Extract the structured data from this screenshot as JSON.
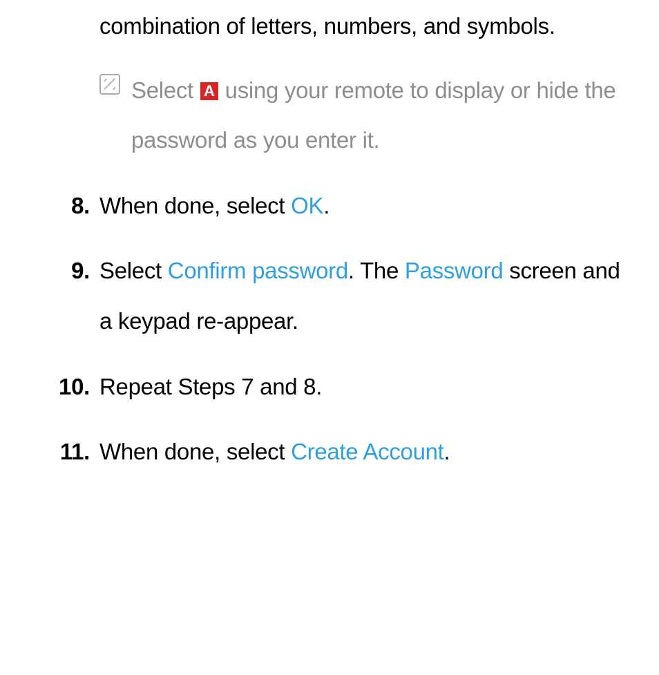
{
  "continuation_text": "combination of letters, numbers, and symbols.",
  "note": {
    "prefix": "Select ",
    "button_label": "A",
    "suffix": " using your remote to display or hide the password as you enter it."
  },
  "steps": [
    {
      "number": "8.",
      "parts": [
        {
          "text": "When done, select ",
          "link": false
        },
        {
          "text": "OK",
          "link": true
        },
        {
          "text": ".",
          "link": false
        }
      ]
    },
    {
      "number": "9.",
      "parts": [
        {
          "text": "Select ",
          "link": false
        },
        {
          "text": "Confirm password",
          "link": true
        },
        {
          "text": ". The ",
          "link": false
        },
        {
          "text": "Password",
          "link": true
        },
        {
          "text": " screen and a keypad re-appear.",
          "link": false
        }
      ]
    },
    {
      "number": "10.",
      "parts": [
        {
          "text": "Repeat Steps 7 and 8.",
          "link": false
        }
      ]
    },
    {
      "number": "11.",
      "parts": [
        {
          "text": "When done, select ",
          "link": false
        },
        {
          "text": "Create Account",
          "link": true
        },
        {
          "text": ".",
          "link": false
        }
      ]
    }
  ]
}
